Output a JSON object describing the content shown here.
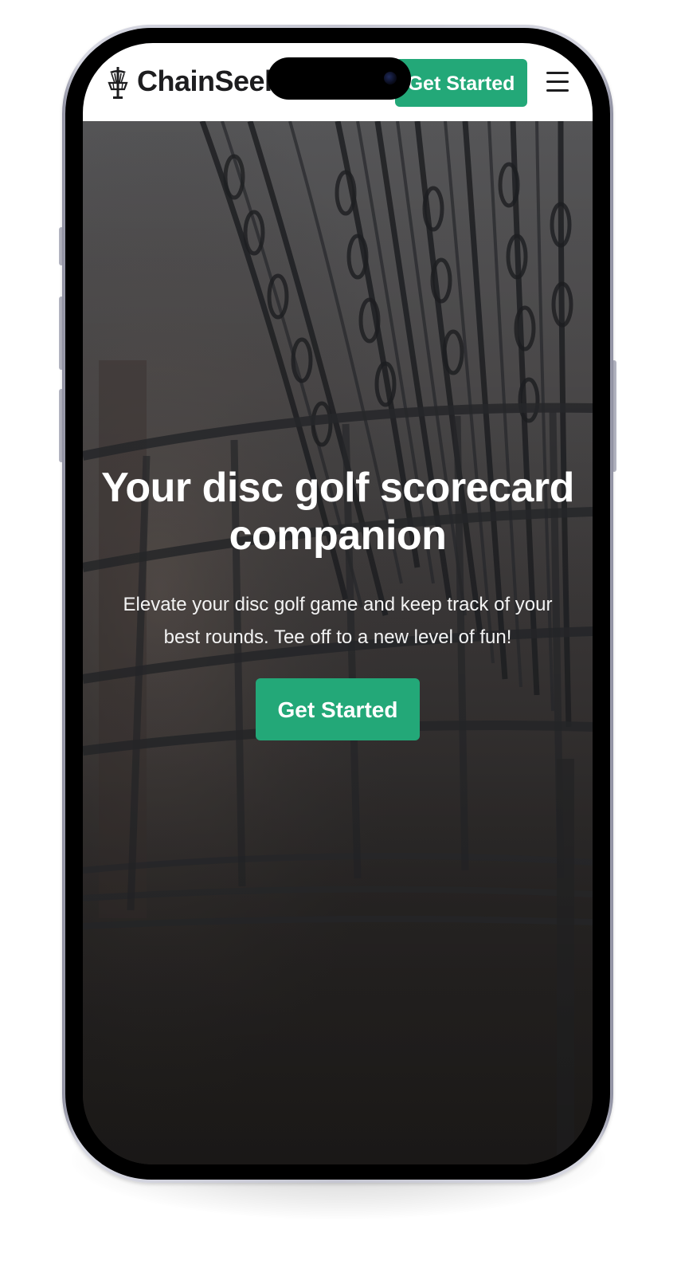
{
  "navbar": {
    "brand": "ChainSeek",
    "cta_label": "Get Started",
    "logo_icon": "disc-golf-basket-icon",
    "menu_icon": "hamburger-menu-icon"
  },
  "hero": {
    "title": "Your disc golf scorecard companion",
    "subtitle": "Elevate your disc golf game and keep track of your best rounds. Tee off to a new level of fun!",
    "cta_label": "Get Started",
    "background": "disc-golf-basket-chains-photo"
  },
  "colors": {
    "accent": "#23a878",
    "navbar_bg": "#ffffff",
    "brand_text": "#1d1d1f",
    "hero_text": "#ffffff"
  }
}
